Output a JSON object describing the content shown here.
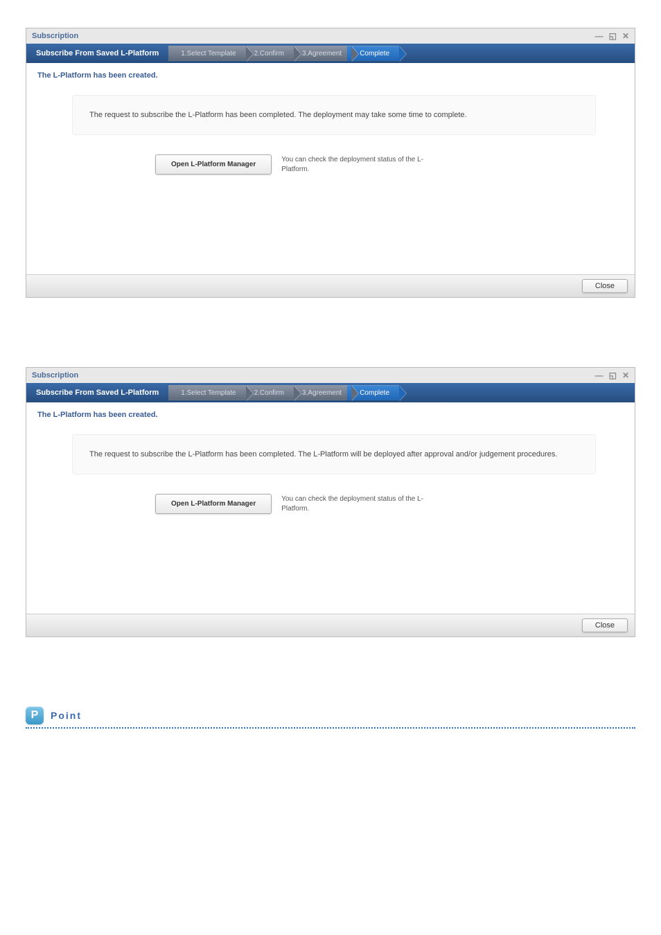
{
  "window1": {
    "title": "Subscription",
    "subtitle": "Subscribe From Saved L-Platform",
    "steps": [
      {
        "label": "1.Select Template",
        "active": false
      },
      {
        "label": "2.Confirm",
        "active": false
      },
      {
        "label": "3.Agreement",
        "active": false
      },
      {
        "label": "Complete",
        "active": true
      }
    ],
    "status": "The L-Platform has been created.",
    "message": "The request to subscribe the L-Platform has been completed. The deployment may take some time to complete.",
    "buttonLabel": "Open L-Platform Manager",
    "buttonDesc": "You can check the deployment status of the L-Platform.",
    "close": "Close"
  },
  "window2": {
    "title": "Subscription",
    "subtitle": "Subscribe From Saved L-Platform",
    "steps": [
      {
        "label": "1.Select Template",
        "active": false
      },
      {
        "label": "2.Confirm",
        "active": false
      },
      {
        "label": "3.Agreement",
        "active": false
      },
      {
        "label": "Complete",
        "active": true
      }
    ],
    "status": "The L-Platform has been created.",
    "message": "The request to subscribe the L-Platform has been completed. The L-Platform will be deployed after approval and/or judgement procedures.",
    "buttonLabel": "Open L-Platform Manager",
    "buttonDesc": "You can check the deployment status of the L-Platform.",
    "close": "Close"
  },
  "point": {
    "icon": "P",
    "label": "Point"
  },
  "controls": {
    "minimize": "—",
    "maximize": "◱",
    "close": "✕"
  }
}
